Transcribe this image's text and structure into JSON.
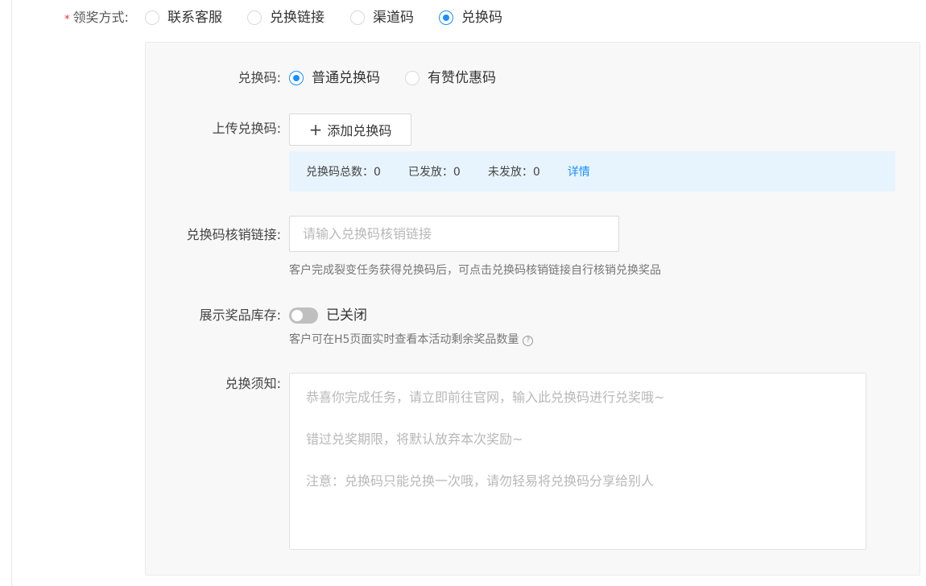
{
  "reward_method": {
    "required_mark": "*",
    "label": "领奖方式:",
    "options": [
      {
        "label": "联系客服",
        "checked": false
      },
      {
        "label": "兑换链接",
        "checked": false
      },
      {
        "label": "渠道码",
        "checked": false
      },
      {
        "label": "兑换码",
        "checked": true
      }
    ]
  },
  "code_type": {
    "label": "兑换码:",
    "options": [
      {
        "label": "普通兑换码",
        "checked": true
      },
      {
        "label": "有赞优惠码",
        "checked": false
      }
    ]
  },
  "upload": {
    "label": "上传兑换码:",
    "button_icon": "+",
    "button_label": "添加兑换码"
  },
  "stats": {
    "total": "兑换码总数：0",
    "issued": "已发放：0",
    "unissued": "未发放：0",
    "details_link": "详情"
  },
  "verify_link": {
    "label": "兑换码核销链接:",
    "value": "",
    "placeholder": "请输入兑换码核销链接",
    "hint": "客户完成裂变任务获得兑换码后，可点击兑换码核销链接自行核销兑换奖品"
  },
  "stock_display": {
    "label": "展示奖品库存:",
    "enabled": false,
    "state_text": "已关闭",
    "hint": "客户可在H5页面实时查看本活动剩余奖品数量",
    "help_icon": "?"
  },
  "notice": {
    "label": "兑换须知:",
    "placeholder_lines": [
      "恭喜你完成任务，请立即前往官网，输入此兑换码进行兑奖哦~",
      "错过兑奖期限，将默认放弃本次奖励~",
      "注意：兑换码只能兑换一次哦，请勿轻易将兑换码分享给别人"
    ]
  },
  "colors": {
    "accent": "#1890ff",
    "required": "#f5222d",
    "stats_bg": "#e8f4fd",
    "panel_bg": "#f8f8f8"
  }
}
